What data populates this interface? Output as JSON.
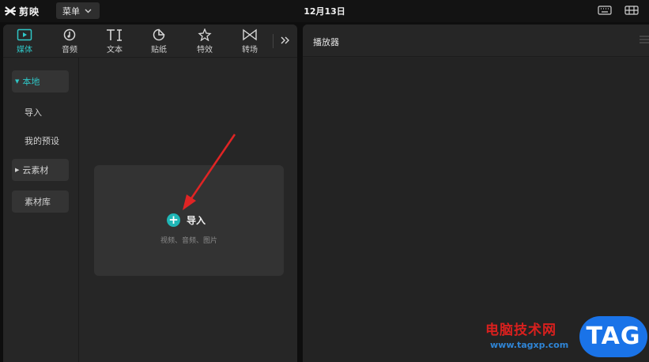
{
  "app": {
    "name": "剪映",
    "project_title": "12月13日"
  },
  "top_menu": {
    "label": "菜单"
  },
  "tabs": [
    {
      "label": "媒体",
      "icon": "media-icon",
      "active": true
    },
    {
      "label": "音频",
      "icon": "audio-icon",
      "active": false
    },
    {
      "label": "文本",
      "icon": "text-icon",
      "active": false
    },
    {
      "label": "贴纸",
      "icon": "sticker-icon",
      "active": false
    },
    {
      "label": "特效",
      "icon": "effects-icon",
      "active": false
    },
    {
      "label": "转场",
      "icon": "transition-icon",
      "active": false
    }
  ],
  "sidebar": {
    "local": "本地",
    "import": "导入",
    "my_presets": "我的预设",
    "cloud": "云素材",
    "library": "素材库"
  },
  "import_card": {
    "label": "导入",
    "hint": "视频、音频、图片"
  },
  "player": {
    "title": "播放器"
  },
  "watermark": {
    "text": "电脑技术网",
    "url": "www.tagxp.com",
    "badge": "TAG"
  },
  "colors": {
    "accent": "#2fc6c6",
    "arrow": "#e02424",
    "watermark_red": "#d9201e",
    "badge_blue": "#1a73e8"
  }
}
